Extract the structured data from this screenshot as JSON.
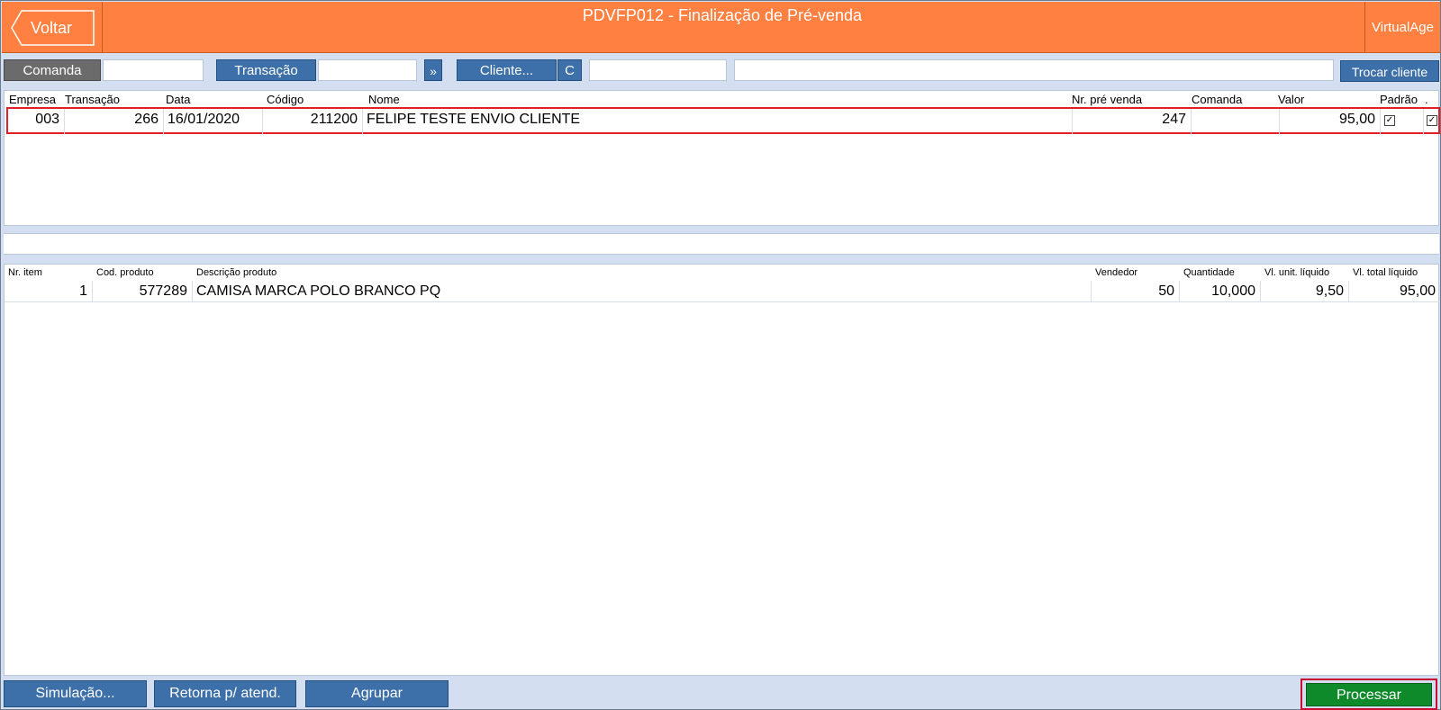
{
  "header": {
    "back_label": "Voltar",
    "title": "PDVFP012 - Finalização de Pré-venda",
    "brand": "VirtualAge"
  },
  "toolbar": {
    "comanda_label": "Comanda",
    "comanda_value": "",
    "transacao_label": "Transação",
    "transacao_value": "",
    "forward_label": "»",
    "cliente_label": "Cliente...",
    "cliente_code_label": "C",
    "cliente_code_value": "",
    "cliente_name_value": "",
    "trocar_label": "Trocar cliente"
  },
  "orders": {
    "columns": [
      "Empresa",
      "Transação",
      "Data",
      "Código",
      "Nome",
      "Nr. pré venda",
      "Comanda",
      "Valor",
      "Padrão",
      "."
    ],
    "rows": [
      {
        "empresa": "003",
        "transacao": "266",
        "data": "16/01/2020",
        "codigo": "211200",
        "nome": "FELIPE TESTE ENVIO CLIENTE",
        "nr_pre_venda": "247",
        "comanda": "",
        "valor": "95,00",
        "padrao": true,
        "sel": true
      }
    ]
  },
  "items": {
    "columns": [
      "Nr. item",
      "Cod. produto",
      "Descrição produto",
      "Vendedor",
      "Quantidade",
      "Vl. unit. líquido",
      "Vl. total líquido"
    ],
    "rows": [
      {
        "nr_item": "1",
        "cod_produto": "577289",
        "descricao": "CAMISA MARCA POLO BRANCO PQ",
        "vendedor": "50",
        "quantidade": "10,000",
        "vl_unit": "9,50",
        "vl_total": "95,00"
      }
    ]
  },
  "footer": {
    "simulacao_label": "Simulação...",
    "retorna_label": "Retorna p/ atend.",
    "agrupar_label": "Agrupar",
    "processar_label": "Processar"
  },
  "colors": {
    "header": "#ff8040",
    "button": "#3d6fa8",
    "process": "#0f8a2a",
    "highlight": "#e21f26"
  }
}
